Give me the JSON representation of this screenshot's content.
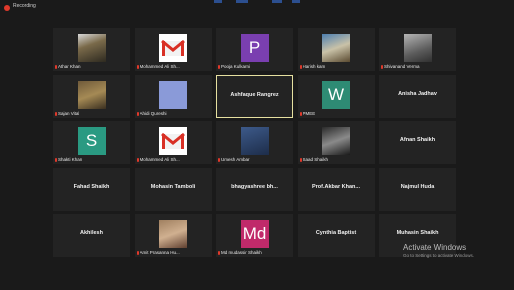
{
  "recording_label": "Recording",
  "tiles": [
    {
      "name": "Athar Khan",
      "kind": "photo",
      "photo": "photo-a"
    },
    {
      "name": "Mohammed Ali Sh...",
      "kind": "gmail"
    },
    {
      "name": "Pooja Kulkarni",
      "kind": "letter",
      "letter": "P",
      "color": "#7a3fb0"
    },
    {
      "name": "Harish kam",
      "kind": "photo",
      "photo": "photo-b"
    },
    {
      "name": "Shivanand Verma",
      "kind": "photo",
      "photo": "photo-c"
    },
    {
      "name": "Sajan Vital",
      "kind": "photo",
      "photo": "photo-d"
    },
    {
      "name": "Ahidi Qureshi",
      "kind": "letter",
      "letter": "",
      "color": "#8a9ad8"
    },
    {
      "center": "Ashfaque Rangrez",
      "kind": "center",
      "active": true
    },
    {
      "name": "PMEE",
      "kind": "letter",
      "letter": "W",
      "color": "#2e8b74"
    },
    {
      "center": "Anisha Jadhav",
      "kind": "center"
    },
    {
      "name": "Shakti Khan",
      "kind": "letter",
      "letter": "S",
      "color": "#2a9a82"
    },
    {
      "name": "Mohammed Ali Sh...",
      "kind": "gmail"
    },
    {
      "name": "Umesh Ambar",
      "kind": "photo",
      "photo": "photo-e"
    },
    {
      "name": "Saad Shaikh",
      "kind": "photo",
      "photo": "photo-f"
    },
    {
      "center": "Afnan Shaikh",
      "kind": "center"
    },
    {
      "center": "Fahad Shaikh",
      "kind": "center"
    },
    {
      "center": "Mohasin Tamboli",
      "kind": "center"
    },
    {
      "center": "bhagyashree bh...",
      "kind": "center"
    },
    {
      "center": "Prof.Akbar Khan...",
      "kind": "center"
    },
    {
      "center": "Najmul Huda",
      "kind": "center"
    },
    {
      "center": "Akhilesh",
      "kind": "center"
    },
    {
      "name": "Amit Prasanna Hu...",
      "kind": "photo",
      "photo": "photo-g"
    },
    {
      "name": "Md mudassir Shaikh",
      "kind": "letter",
      "letter": "Md",
      "color": "#c02a6a"
    },
    {
      "center": "Cynthia Baptist",
      "kind": "center"
    },
    {
      "center": "Muhasin Shaikh",
      "kind": "center"
    }
  ],
  "watermark": {
    "title": "Activate Windows",
    "subtitle": "Go to Settings to activate Windows."
  }
}
